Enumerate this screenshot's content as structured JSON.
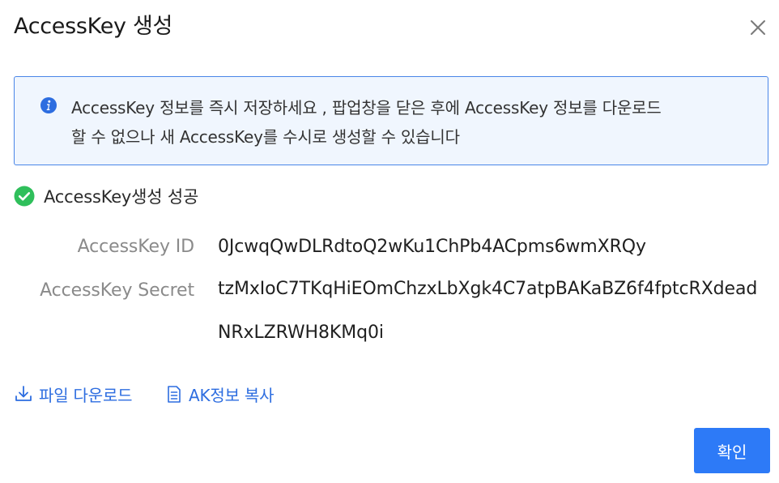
{
  "dialog": {
    "title": "AccessKey 생성",
    "close_icon": "close-icon"
  },
  "alert": {
    "icon": "info-icon",
    "line1": "AccessKey 정보를 즉시 저장하세요 , 팝업창을 닫은 후에 AccessKey 정보를 다운로드",
    "line2": "할 수 없으나 새 AccessKey를 수시로 생성할 수 있습니다",
    "border_color": "#4a86e8",
    "background_color": "#f0f6fe"
  },
  "status": {
    "icon": "check-circle-icon",
    "text": "AccessKey생성 성공",
    "color": "#2fbf5b"
  },
  "fields": {
    "id_label": "AccessKey ID",
    "id_value": "0JcwqQwDLRdtoQ2wKu1ChPb4ACpms6wmXRQy",
    "secret_label": "AccessKey Secret",
    "secret_value": "tzMxIoC7TKqHiEOmChzxLbXgk4C7atpBAKaBZ6f4fptcRXdeadNRxLZRWH8KMq0i"
  },
  "actions": {
    "download_icon": "download-icon",
    "download_label": "파일 다운로드",
    "copy_icon": "copy-document-icon",
    "copy_label": "AK정보 복사",
    "link_color": "#2d6de0"
  },
  "footer": {
    "confirm_label": "확인",
    "confirm_color": "#2d7af7"
  }
}
